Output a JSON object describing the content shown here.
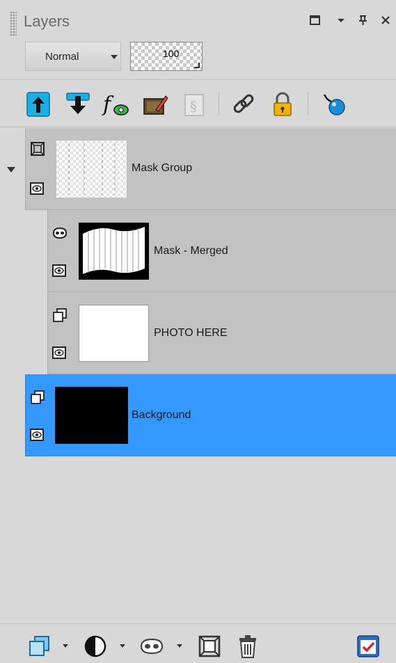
{
  "panel": {
    "title": "Layers",
    "controls": {
      "restore": "☐",
      "menu": "▾",
      "pin": "ꟼ",
      "close": "✕"
    }
  },
  "blend": {
    "mode": "Normal",
    "opacity": "100"
  },
  "toolbar": {
    "icons": [
      "move-up-icon",
      "move-down-icon",
      "layer-styles-icon",
      "edit-selection-icon",
      "properties-icon",
      "link-icon",
      "lock-icon",
      "pick-icon"
    ]
  },
  "layers": [
    {
      "name": "Mask Group",
      "kind": "group",
      "expanded": true
    },
    {
      "name": "Mask - Merged",
      "kind": "mask"
    },
    {
      "name": "PHOTO HERE",
      "kind": "raster"
    },
    {
      "name": "Background",
      "kind": "raster",
      "selected": true
    }
  ],
  "colors": {
    "selection": "#3399ff",
    "row": "#c2c2c2",
    "panel": "#d8d8d8",
    "up_arrow": "#1ab0e6"
  },
  "bottombar": {
    "icons": [
      "new-raster-layer-icon",
      "new-adjustment-layer-icon",
      "new-mask-layer-icon",
      "new-group-icon",
      "delete-layer-icon",
      "layer-properties-icon"
    ]
  }
}
